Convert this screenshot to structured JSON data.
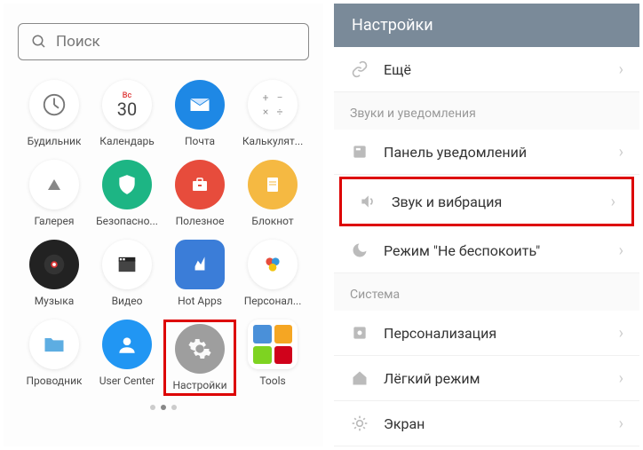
{
  "left": {
    "search_placeholder": "Поиск",
    "calendar": {
      "dow": "Вс",
      "day": "30"
    },
    "apps": [
      {
        "id": "alarm",
        "label": "Будильник"
      },
      {
        "id": "calendar",
        "label": "Календарь"
      },
      {
        "id": "mail",
        "label": "Почта"
      },
      {
        "id": "calc",
        "label": "Калькулят..."
      },
      {
        "id": "gallery",
        "label": "Галерея"
      },
      {
        "id": "security",
        "label": "Безопасно..."
      },
      {
        "id": "useful",
        "label": "Полезное"
      },
      {
        "id": "notes",
        "label": "Блокнот"
      },
      {
        "id": "music",
        "label": "Музыка"
      },
      {
        "id": "video",
        "label": "Видео"
      },
      {
        "id": "hotapps",
        "label": "Hot Apps"
      },
      {
        "id": "personal",
        "label": "Персонал..."
      },
      {
        "id": "explorer",
        "label": "Проводник"
      },
      {
        "id": "usercenter",
        "label": "User Center"
      },
      {
        "id": "settings",
        "label": "Настройки"
      },
      {
        "id": "tools",
        "label": "Tools"
      }
    ]
  },
  "right": {
    "title": "Настройки",
    "more": "Ещё",
    "section1": "Звуки и уведомления",
    "row_notif": "Панель уведомлений",
    "row_sound": "Звук и вибрация",
    "row_dnd": "Режим \"Не беспокоить\"",
    "section2": "Система",
    "row_personal": "Персонализация",
    "row_easy": "Лёгкий режим",
    "row_display": "Экран"
  }
}
